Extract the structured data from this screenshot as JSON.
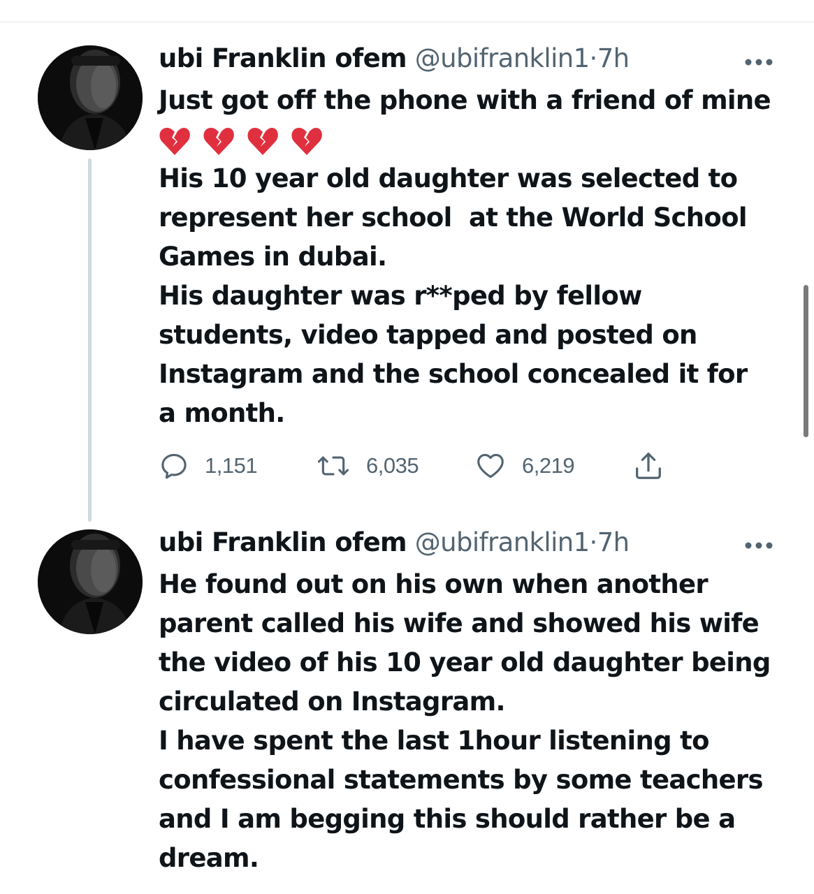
{
  "tweets": [
    {
      "display_name": "ubi Franklin ofem",
      "handle": "@ubifranklin1",
      "separator": "·",
      "time": "7h",
      "lines": [
        "Just got off the phone with a friend of mine",
        "💔💔💔💔",
        "His 10 year old daughter was selected to",
        "represent her school  at the World School",
        "Games in dubai.",
        "His daughter was r**ped by fellow",
        "students, video tapped and posted on",
        "Instagram and the school concealed it for",
        "a month."
      ],
      "stats": {
        "replies": "1,151",
        "retweets": "6,035",
        "likes": "6,219"
      }
    },
    {
      "display_name": "ubi Franklin ofem",
      "handle": "@ubifranklin1",
      "separator": "·",
      "time": "7h",
      "lines": [
        "He found out on his own when another",
        "parent called his wife and showed his wife",
        "the video of his 10 year old daughter being",
        "circulated on Instagram.",
        "I have spent the last 1hour listening to",
        "confessional statements by some teachers",
        "and I am begging this should rather be a",
        "dream."
      ]
    }
  ],
  "icons": {
    "more": "more-horizontal-icon",
    "reply": "reply-bubble-icon",
    "retweet": "retweet-icon",
    "like": "heart-icon",
    "share": "share-upload-icon",
    "emoji": "broken-heart-emoji"
  },
  "colors": {
    "text": "#0f1419",
    "secondary": "#536471",
    "thread_line": "#cfd9de",
    "broken_heart": "#e0303f"
  }
}
